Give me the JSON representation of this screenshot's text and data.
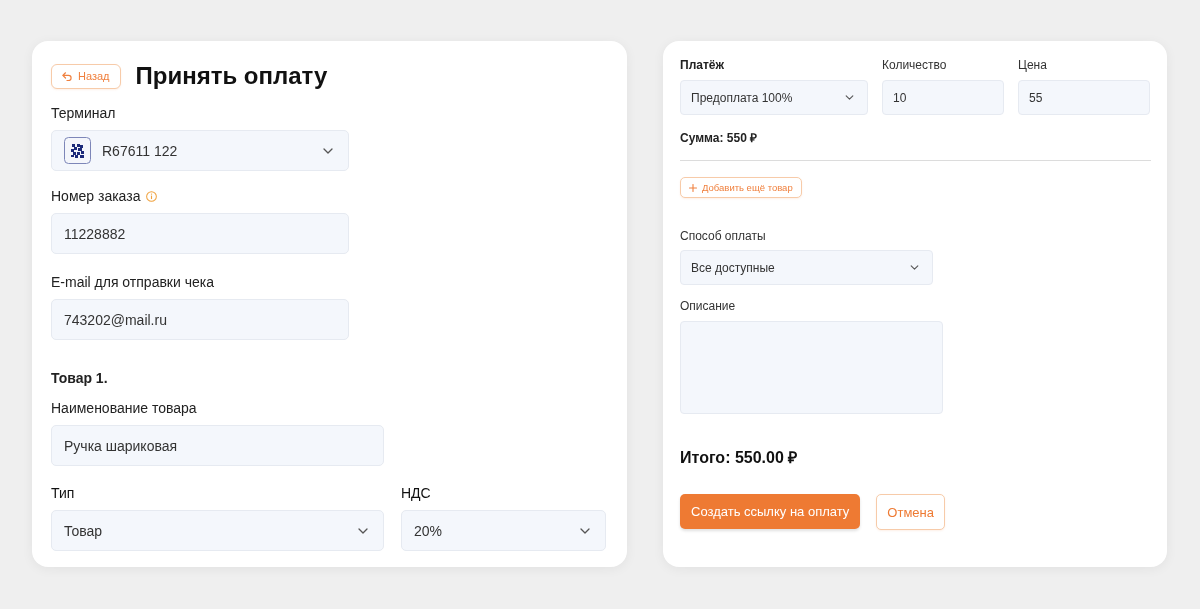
{
  "payment_card": {
    "back_button": {
      "label": "Назад"
    },
    "title": "Принять оплату",
    "terminal": {
      "label": "Терминал",
      "value": "R67611 122"
    },
    "order_number": {
      "label": "Номер заказа",
      "value": "11228882"
    },
    "email": {
      "label": "E-mail для отправки чека",
      "value": "743202@mail.ru"
    },
    "item_heading": "Товар 1.",
    "item_name": {
      "label": "Наименование товара",
      "value": "Ручка шариковая"
    },
    "item_type": {
      "label": "Тип",
      "value": "Товар"
    },
    "vat": {
      "label": "НДС",
      "value": "20%"
    }
  },
  "item_card": {
    "payment": {
      "label": "Платёж",
      "value": "Предоплата 100%"
    },
    "quantity": {
      "label": "Количество",
      "value": "10"
    },
    "price": {
      "label": "Цена",
      "value": "55"
    },
    "sum": "Сумма: 550 ₽",
    "add_item_button": {
      "label": "Добавить ещё товар"
    },
    "payment_method": {
      "label": "Способ оплаты",
      "value": "Все доступные"
    },
    "description": {
      "label": "Описание"
    },
    "total": "Итого: 550.00 ₽",
    "buttons": [
      {
        "label": "Создать ссылку на оплату",
        "kind": "primary"
      },
      {
        "label": "Отмена",
        "kind": "secondary"
      }
    ]
  }
}
